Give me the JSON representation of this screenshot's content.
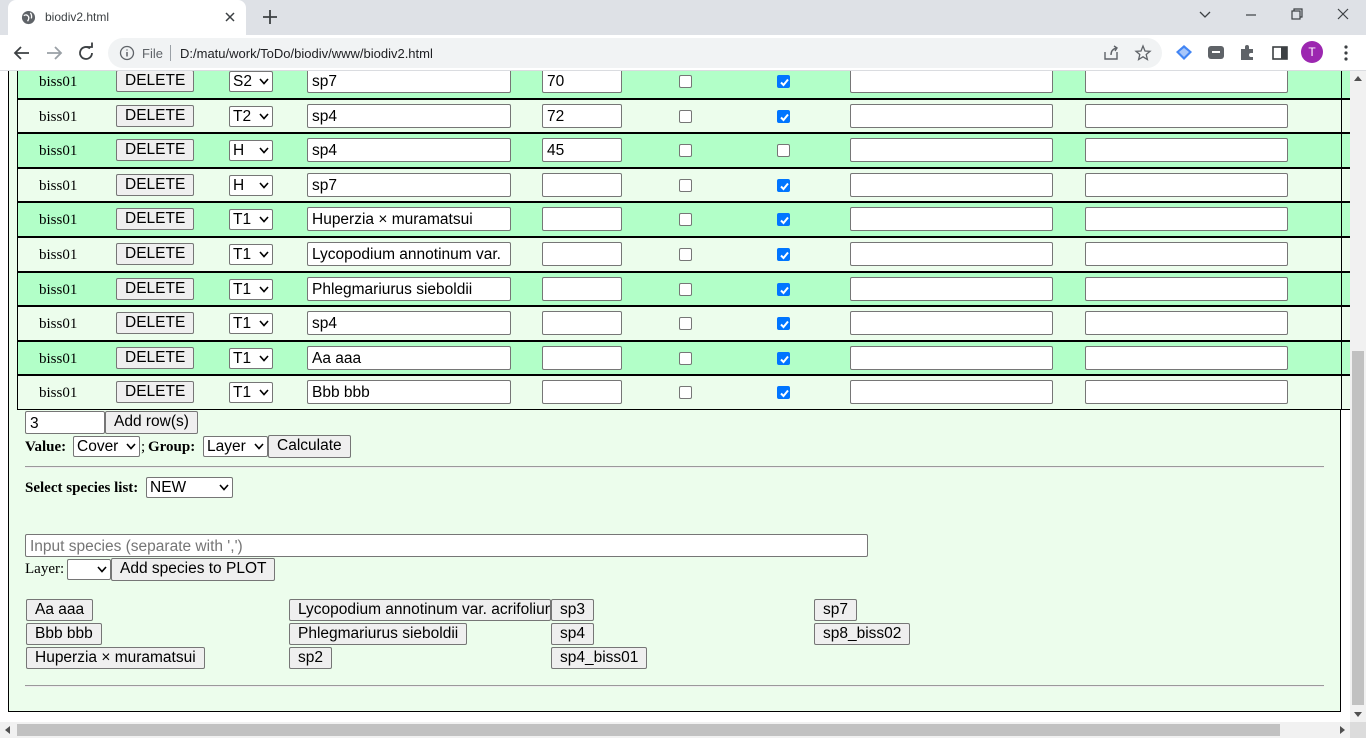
{
  "browser": {
    "tab_title": "biodiv2.html",
    "scheme": "File",
    "url": "D:/matu/work/ToDo/biodiv/www/biodiv2.html",
    "profile_initial": "T",
    "profile_color": "#9c27b0"
  },
  "table": {
    "delete_label": "DELETE",
    "rows": [
      {
        "id": "biss01",
        "layer": "S2",
        "species": "sp7",
        "value": "70",
        "cb1": false,
        "cb2": true,
        "note1": "",
        "note2": ""
      },
      {
        "id": "biss01",
        "layer": "T2",
        "species": "sp4",
        "value": "72",
        "cb1": false,
        "cb2": true,
        "note1": "",
        "note2": ""
      },
      {
        "id": "biss01",
        "layer": "H",
        "species": "sp4",
        "value": "45",
        "cb1": false,
        "cb2": false,
        "note1": "",
        "note2": ""
      },
      {
        "id": "biss01",
        "layer": "H",
        "species": "sp7",
        "value": "",
        "cb1": false,
        "cb2": true,
        "note1": "",
        "note2": ""
      },
      {
        "id": "biss01",
        "layer": "T1",
        "species": "Huperzia × muramatsui",
        "value": "",
        "cb1": false,
        "cb2": true,
        "note1": "",
        "note2": ""
      },
      {
        "id": "biss01",
        "layer": "T1",
        "species": "Lycopodium annotinum var.",
        "value": "",
        "cb1": false,
        "cb2": true,
        "note1": "",
        "note2": ""
      },
      {
        "id": "biss01",
        "layer": "T1",
        "species": "Phlegmariurus sieboldii",
        "value": "",
        "cb1": false,
        "cb2": true,
        "note1": "",
        "note2": ""
      },
      {
        "id": "biss01",
        "layer": "T1",
        "species": "sp4",
        "value": "",
        "cb1": false,
        "cb2": true,
        "note1": "",
        "note2": ""
      },
      {
        "id": "biss01",
        "layer": "T1",
        "species": "Aa aaa",
        "value": "",
        "cb1": false,
        "cb2": true,
        "note1": "",
        "note2": ""
      },
      {
        "id": "biss01",
        "layer": "T1",
        "species": "Bbb bbb",
        "value": "",
        "cb1": false,
        "cb2": true,
        "note1": "",
        "note2": ""
      }
    ]
  },
  "controls": {
    "row_count": "3",
    "add_rows_label": "Add row(s)",
    "value_label": "Value:",
    "value_selected": "Cover",
    "separator": ";",
    "group_label": "Group:",
    "group_selected": "Layer",
    "calculate_label": "Calculate"
  },
  "species_list": {
    "label": "Select species list:",
    "selected": "NEW",
    "input_placeholder": "Input species (separate with ',')",
    "layer_label": "Layer:",
    "layer_selected": "",
    "add_label": "Add species to PLOT"
  },
  "species_buttons": {
    "col1": [
      "Aa aaa",
      "Bbb bbb",
      "Huperzia × muramatsui"
    ],
    "col2": [
      "Lycopodium annotinum var. acrifolium",
      "Phlegmariurus sieboldii",
      "sp2"
    ],
    "col3": [
      "sp3",
      "sp4",
      "sp4_biss01"
    ],
    "col4": [
      "sp7",
      "sp8_biss02"
    ]
  },
  "colors": {
    "row_even": "#b2ffc8",
    "row_odd": "#ecfdec",
    "checkbox_checked": "#0075ff"
  }
}
